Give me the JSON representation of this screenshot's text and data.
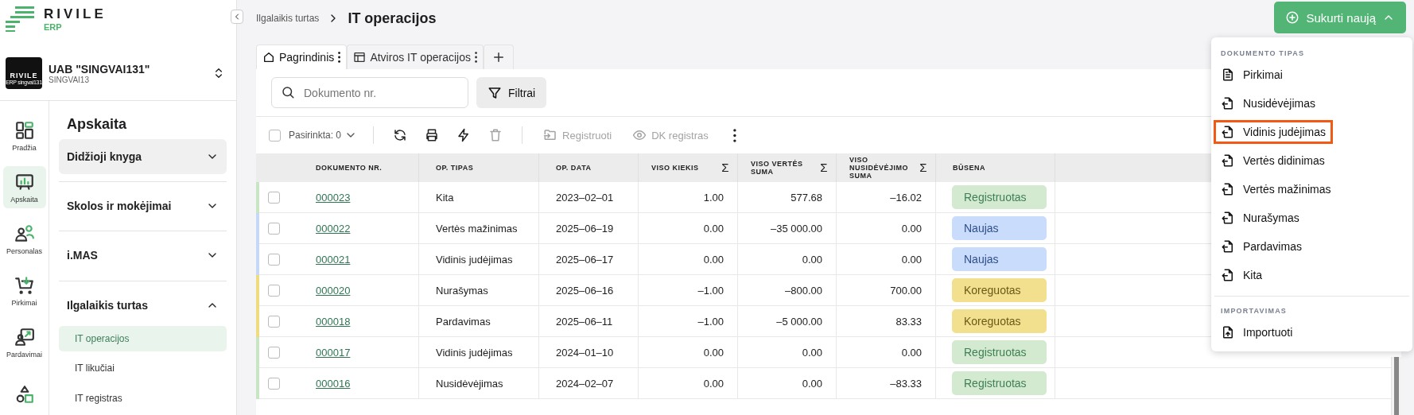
{
  "logo": {
    "name": "RIVILE",
    "sub": "ERP"
  },
  "company": {
    "badge_name": "RIVILE",
    "badge_sub": "ERP singvai131",
    "name": "UAB \"SINGVAI131\"",
    "code": "SINGVAI13"
  },
  "rail": [
    {
      "label": "Pradžia",
      "selected": false
    },
    {
      "label": "Apskaita",
      "selected": true
    },
    {
      "label": "Personalas",
      "selected": false
    },
    {
      "label": "Pirkimai",
      "selected": false
    },
    {
      "label": "Pardavimai",
      "selected": false
    },
    {
      "selected": false
    }
  ],
  "nav": {
    "title": "Apskaita",
    "groups": [
      {
        "label": "Didžioji knyga",
        "expanded": false,
        "highlighted": true
      },
      {
        "label": "Skolos ir mokėjimai",
        "expanded": false,
        "highlighted": false
      },
      {
        "label": "i.MAS",
        "expanded": false,
        "highlighted": false
      },
      {
        "label": "Ilgalaikis turtas",
        "expanded": true,
        "highlighted": false,
        "children": [
          {
            "label": "IT operacijos",
            "selected": true
          },
          {
            "label": "IT likučiai",
            "selected": false
          },
          {
            "label": "IT registras",
            "selected": false
          }
        ]
      }
    ]
  },
  "breadcrumb": {
    "parent": "Ilgalaikis turtas",
    "current": "IT operacijos"
  },
  "create_button": {
    "label": "Sukurti naują",
    "expanded": true
  },
  "tabs": [
    {
      "label": "Pagrindinis",
      "selected": true
    },
    {
      "label": "Atviros IT operacijos",
      "selected": false
    }
  ],
  "search": {
    "placeholder": "Dokumento nr."
  },
  "filter_button": {
    "label": "Filtrai"
  },
  "toolbar": {
    "selection_label": "Pasirinkta: 0",
    "select_all_checked": false,
    "icon_buttons": [
      {
        "disabled": false
      },
      {
        "disabled": false
      },
      {
        "disabled": false
      },
      {
        "disabled": true
      }
    ],
    "actions": [
      {
        "label": "Registruoti",
        "disabled": true
      },
      {
        "label": "DK registras",
        "disabled": true
      }
    ]
  },
  "table": {
    "columns": [
      {
        "label": "DOKUMENTO NR."
      },
      {
        "label": "OP. TIPAS"
      },
      {
        "label": "OP. DATA"
      },
      {
        "label": "VISO KIEKIS",
        "sum": "Σ"
      },
      {
        "label": "VISO VERTĖS SUMA",
        "sum": "Σ"
      },
      {
        "label": "VISO NUSIDĖVĖJIMO SUMA",
        "sum": "Σ"
      },
      {
        "label": "BŪSENA"
      }
    ],
    "rows": [
      {
        "doc": "000023",
        "type": "Kita",
        "date": "2023–02–01",
        "qty": "1.00",
        "value": "577.68",
        "depreciation": "–16.02",
        "status": {
          "label": "Registruotas",
          "kind": "registered"
        },
        "checked": false
      },
      {
        "doc": "000022",
        "type": "Vertės mažinimas",
        "date": "2025–06–19",
        "qty": "0.00",
        "value": "–35 000.00",
        "depreciation": "0.00",
        "status": {
          "label": "Naujas",
          "kind": "new"
        },
        "checked": false
      },
      {
        "doc": "000021",
        "type": "Vidinis judėjimas",
        "date": "2025–06–17",
        "qty": "0.00",
        "value": "0.00",
        "depreciation": "0.00",
        "status": {
          "label": "Naujas",
          "kind": "new"
        },
        "checked": false
      },
      {
        "doc": "000020",
        "type": "Nurašymas",
        "date": "2025–06–16",
        "qty": "–1.00",
        "value": "–800.00",
        "depreciation": "700.00",
        "status": {
          "label": "Koreguotas",
          "kind": "corrected"
        },
        "checked": false
      },
      {
        "doc": "000018",
        "type": "Pardavimas",
        "date": "2025–06–11",
        "qty": "–1.00",
        "value": "–5 000.00",
        "depreciation": "83.33",
        "status": {
          "label": "Koreguotas",
          "kind": "corrected"
        },
        "checked": false
      },
      {
        "doc": "000017",
        "type": "Vidinis judėjimas",
        "date": "2024–01–10",
        "qty": "0.00",
        "value": "0.00",
        "depreciation": "0.00",
        "status": {
          "label": "Registruotas",
          "kind": "registered"
        },
        "checked": false
      },
      {
        "doc": "000016",
        "type": "Nusidėvėjimas",
        "date": "2024–02–07",
        "qty": "0.00",
        "value": "0.00",
        "depreciation": "–83.33",
        "status": {
          "label": "Registruotas",
          "kind": "registered"
        },
        "checked": false
      }
    ]
  },
  "menu": {
    "sections": [
      {
        "title": "DOKUMENTO TIPAS",
        "items": [
          {
            "label": "Pirkimai",
            "highlighted": false
          },
          {
            "label": "Nusidėvėjimas",
            "highlighted": false
          },
          {
            "label": "Vidinis judėjimas",
            "highlighted": true
          },
          {
            "label": "Vertės didinimas",
            "highlighted": false
          },
          {
            "label": "Vertės mažinimas",
            "highlighted": false
          },
          {
            "label": "Nurašymas",
            "highlighted": false
          },
          {
            "label": "Pardavimas",
            "highlighted": false
          },
          {
            "label": "Kita",
            "highlighted": false
          }
        ]
      },
      {
        "title": "IMPORTAVIMAS",
        "items": [
          {
            "label": "Importuoti",
            "highlighted": false
          }
        ]
      }
    ]
  }
}
